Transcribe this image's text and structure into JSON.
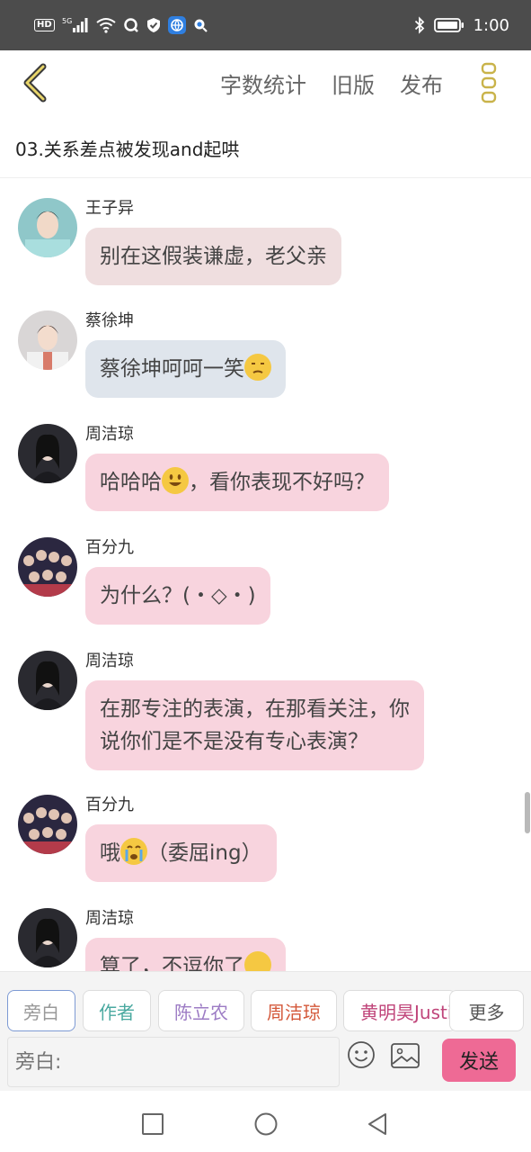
{
  "status_bar": {
    "left_icons": [
      "hd-icon",
      "signal-icon",
      "wifi-icon",
      "app-q-icon",
      "shield-icon",
      "browser-icon",
      "app-search-icon"
    ],
    "hd_label": "HD",
    "signal_label": "5G",
    "time": "1:00",
    "bluetooth_icon": "bluetooth-icon",
    "battery_icon": "battery-icon"
  },
  "top_bar": {
    "back_icon": "chevron-left-icon",
    "actions": [
      "字数统计",
      "旧版",
      "发布"
    ],
    "more_icon": "vertical-dots-icon",
    "accent_color": "#c9b34a"
  },
  "chapter_title": "03.关系差点被发现and起哄",
  "messages": [
    {
      "sender": "王子异",
      "text": "别在这假装谦虚，老父亲",
      "bubble_color": "#efdedf"
    },
    {
      "sender": "蔡徐坤",
      "text": "蔡徐坤呵呵一笑",
      "emoji": "unamused-face-emoji",
      "bubble_color": "#dfe5ec"
    },
    {
      "sender": "周洁琼",
      "text_before": "哈哈哈",
      "emoji": "smiling-face-emoji",
      "text_after": "，看你表现不好吗？",
      "bubble_color": "#f8d4de"
    },
    {
      "sender": "百分九",
      "text": "为什么？(・◇・)",
      "bubble_color": "#f8d4de"
    },
    {
      "sender": "周洁琼",
      "line1": "在那专注的表演，在那看关注，你",
      "line2": "说你们是不是没有专心表演？",
      "bubble_color": "#f8d4de"
    },
    {
      "sender": "百分九",
      "text_before": "哦",
      "emoji": "crying-face-emoji",
      "text_after": "（委屈ing）",
      "bubble_color": "#f8d4de"
    },
    {
      "sender": "周洁琼",
      "text": "算了，不逗你了",
      "emoji": "smiling-face-emoji",
      "bubble_color": "#f8d4de"
    }
  ],
  "roles": [
    {
      "label": "旁白",
      "color": "#999999",
      "active": true
    },
    {
      "label": "作者",
      "color": "#4aa9a0"
    },
    {
      "label": "陈立农",
      "color": "#9c7bc4"
    },
    {
      "label": "周洁琼",
      "color": "#d4593b"
    },
    {
      "label": "黄明昊Justin",
      "color": "#c0457a"
    },
    {
      "label": "更多",
      "color": "#555555"
    }
  ],
  "input": {
    "placeholder": "旁白:",
    "emoji_icon": "smiley-icon",
    "image_icon": "image-icon",
    "send_label": "发送",
    "send_color": "#ee6a95"
  },
  "nav_bar": {
    "icons": [
      "recent-apps-icon",
      "home-icon",
      "back-triangle-icon"
    ]
  }
}
